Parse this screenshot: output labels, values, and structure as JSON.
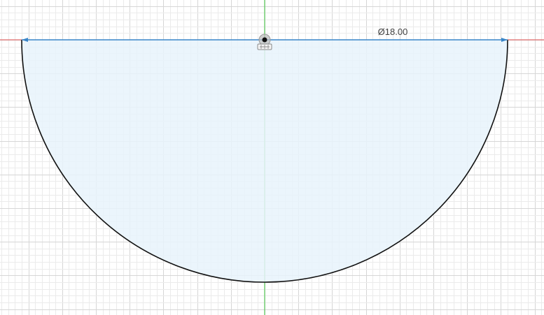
{
  "sketch": {
    "dimension": {
      "value": "Ø18.00"
    },
    "colors": {
      "background": "#ffffff",
      "grid_major": "#d6d6d6",
      "grid_minor": "#ebebeb",
      "x_axis": "#e05050",
      "y_axis": "#3cc43c",
      "profile_fill": "#e8f3fb",
      "profile_stroke": "#111111",
      "dimension_line": "#3a86c8"
    },
    "icons": {
      "origin": "origin-point-icon",
      "constraint": "coincident-constraint-icon"
    }
  }
}
